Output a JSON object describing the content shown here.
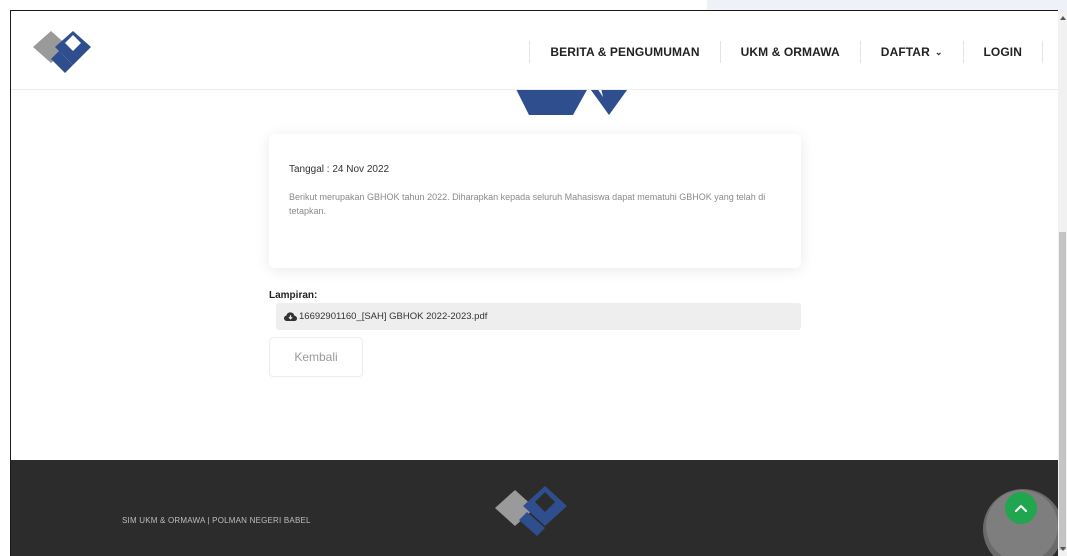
{
  "header": {
    "logo_icon": "brand-diamond-logo",
    "nav": [
      {
        "label": "BERITA & PENGUMUMAN"
      },
      {
        "label": "UKM & ORMAWA"
      },
      {
        "label": "DAFTAR",
        "icon": "chevron-down-icon"
      },
      {
        "label": "LOGIN"
      }
    ]
  },
  "content": {
    "date_text": "Tanggal : 24 Nov 2022",
    "body_text": "Berikut merupakan GBHOK tahun 2022. Diharapkan kepada seluruh Mahasiswa dapat mematuhi GBHOK yang telah di tetapkan.",
    "attachment_label": "Lampiran:",
    "attachment_icon": "cloud-download-icon",
    "attachment_file": "16692901160_[SAH] GBHOK 2022-2023.pdf",
    "back_button": "Kembali"
  },
  "footer": {
    "text": "SIM UKM & ORMAWA | POLMAN NEGERI BABEL",
    "logo_icon": "brand-diamond-logo",
    "back_to_top_icon": "chevron-up-icon"
  },
  "colors": {
    "brand_navy": "#2e4e8d",
    "brand_gray": "#9a9a9a",
    "footer_bg": "#2c2c2c",
    "back_to_top": "#1fa64f"
  }
}
